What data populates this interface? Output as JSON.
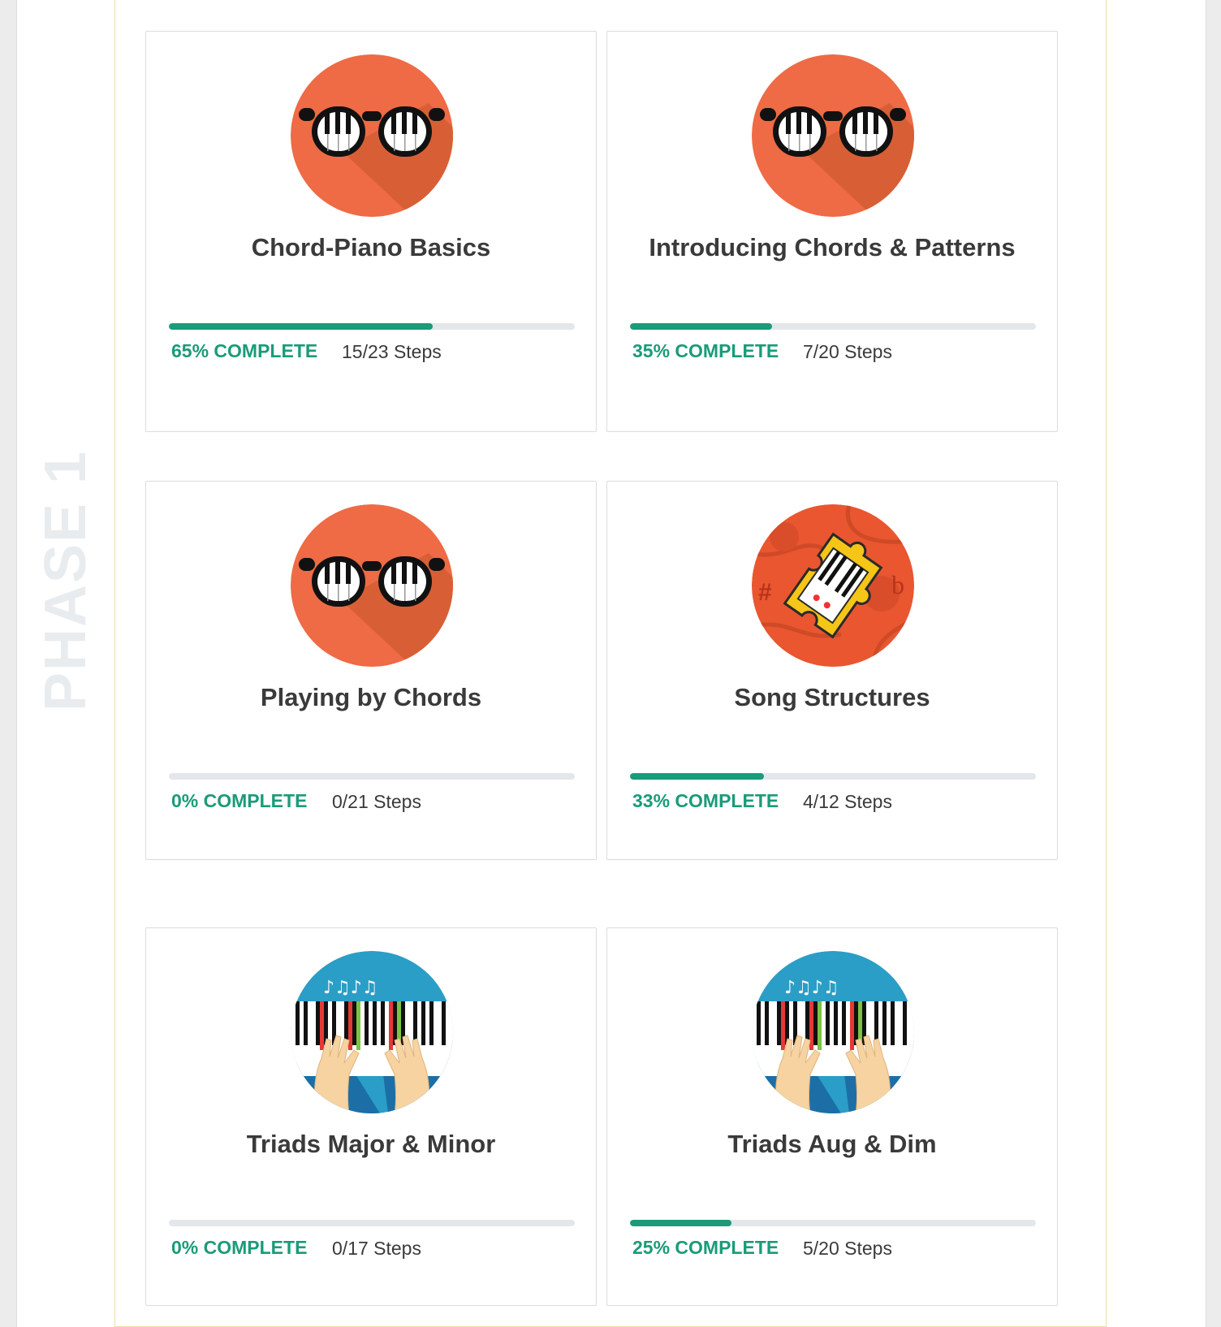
{
  "phase": {
    "label": "PHASE 1"
  },
  "colors": {
    "accent": "#1a9b79",
    "track": "#e3e6eb",
    "title": "#3a3a3a",
    "phase_label": "#e9ecef",
    "panel_border": "#ecdfa8"
  },
  "courses": [
    {
      "title": "Chord-Piano Basics",
      "progress_label": "65% COMPLETE",
      "progress_percent": 65,
      "steps": "15/23 Steps",
      "icon": "piano-glasses-icon"
    },
    {
      "title": "Introducing Chords & Patterns",
      "progress_label": "35% COMPLETE",
      "progress_percent": 35,
      "steps": "7/20 Steps",
      "icon": "piano-glasses-icon"
    },
    {
      "title": "Playing by Chords",
      "progress_label": "0% COMPLETE",
      "progress_percent": 0,
      "steps": "0/21 Steps",
      "icon": "piano-glasses-icon"
    },
    {
      "title": "Song Structures",
      "progress_label": "33% COMPLETE",
      "progress_percent": 33,
      "steps": "4/12 Steps",
      "icon": "puzzle-piece-icon"
    },
    {
      "title": "Triads Major & Minor",
      "progress_label": "0% COMPLETE",
      "progress_percent": 0,
      "steps": "0/17 Steps",
      "icon": "piano-hands-icon"
    },
    {
      "title": "Triads Aug & Dim",
      "progress_label": "25% COMPLETE",
      "progress_percent": 25,
      "steps": "5/20 Steps",
      "icon": "piano-hands-icon"
    }
  ]
}
